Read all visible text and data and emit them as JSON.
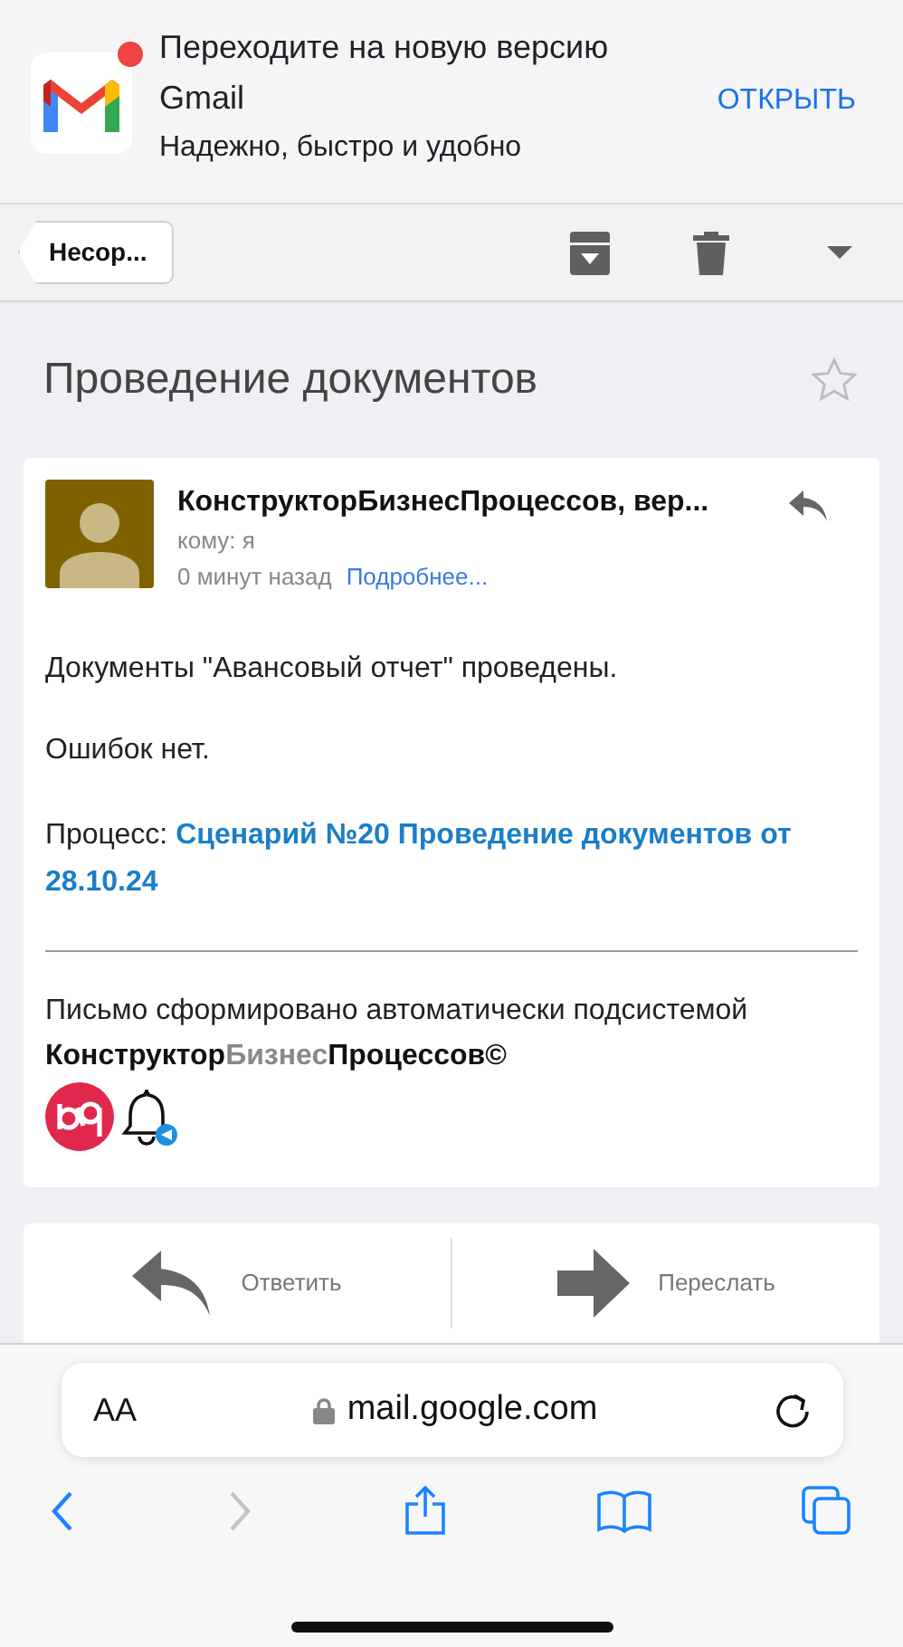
{
  "banner": {
    "title": "Переходите на новую версию Gmail",
    "subtitle": "Надежно, быстро и удобно",
    "action": "ОТКРЫТЬ",
    "notification": true
  },
  "toolbar": {
    "back_label": "Несор..."
  },
  "message": {
    "subject": "Проведение документов",
    "starred": false,
    "sender": "КонструкторБизнесПроцессов, вер...",
    "to": "кому: я",
    "time": "0 минут назад",
    "details_link": "Подробнее...",
    "paragraphs": [
      "Документы \"Авансовый отчет\" проведены.",
      "Ошибок нет."
    ],
    "process": {
      "label": "Процесс:",
      "link": "Сценарий №20 Проведение документов от 28.10.24"
    },
    "signature": "Письмо сформировано автоматически подсистемой",
    "brand": [
      {
        "text": "Конструктор",
        "kind": "strong"
      },
      {
        "text": "Бизнес",
        "kind": "light"
      },
      {
        "text": "Процессов",
        "kind": "strong"
      },
      {
        "text": "©",
        "kind": "strong"
      }
    ]
  },
  "actions": [
    {
      "kind": "reply",
      "label": "Ответить"
    },
    {
      "kind": "forward",
      "label": "Переслать"
    }
  ],
  "browser": {
    "text_size": "AA",
    "url": "mail.google.com",
    "back_enabled": true,
    "forward_enabled": false
  }
}
